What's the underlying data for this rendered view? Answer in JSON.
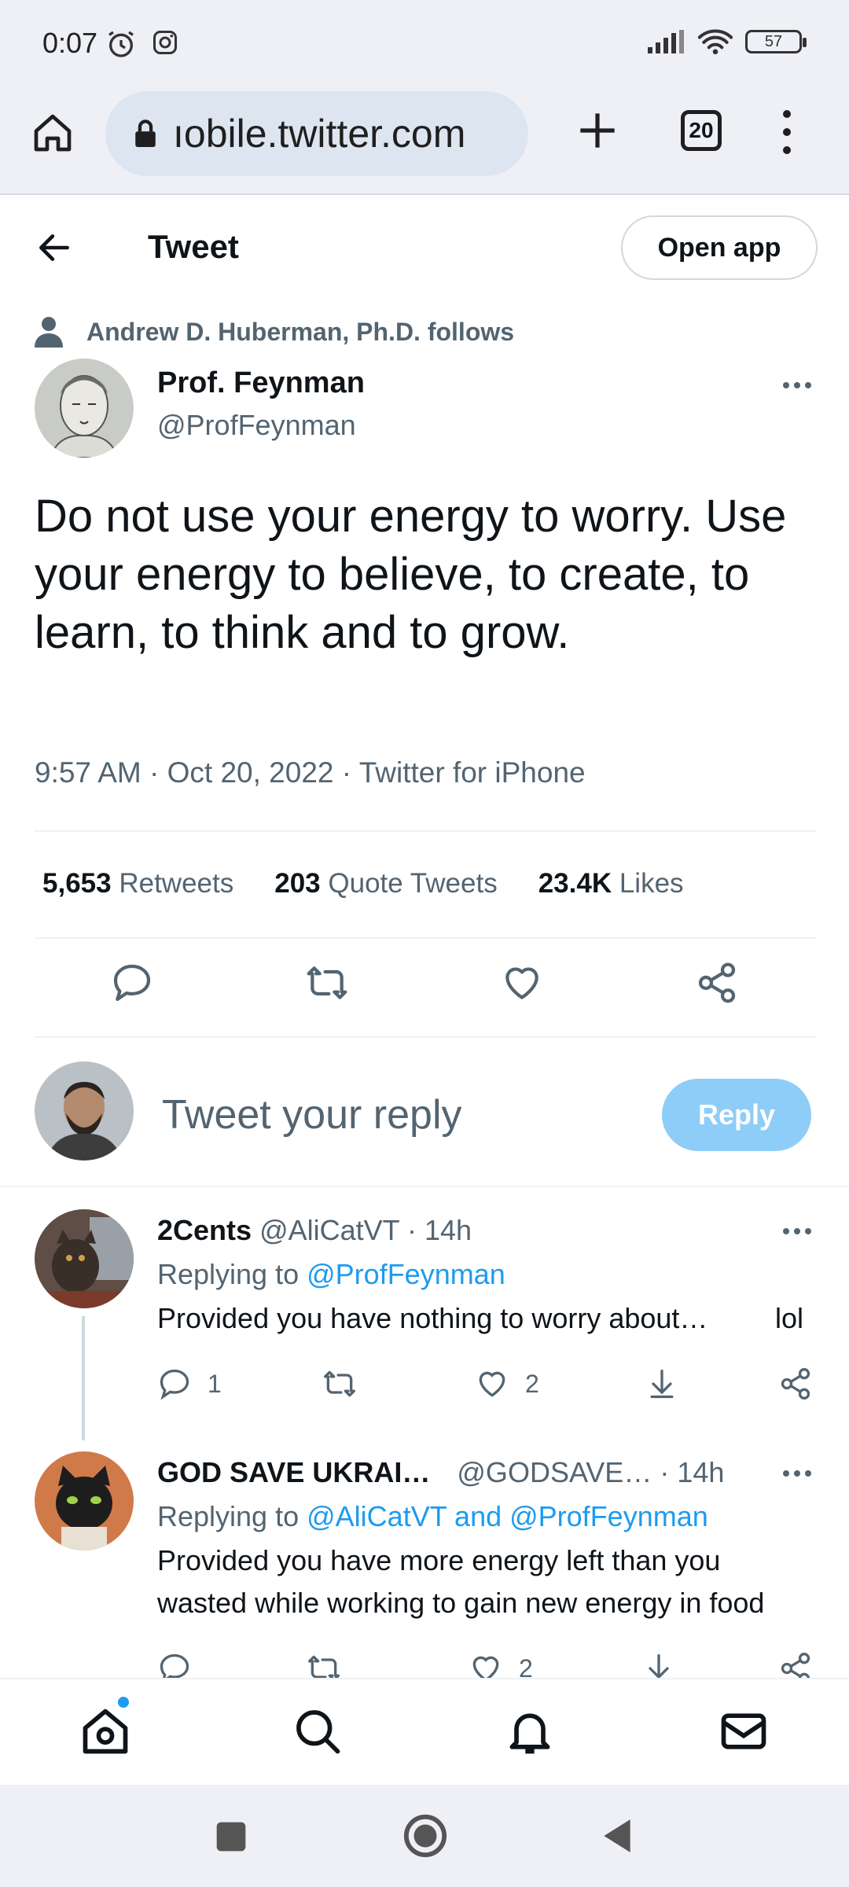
{
  "status": {
    "time": "0:07",
    "battery": "57"
  },
  "browser": {
    "url": "ıobile.twitter.com",
    "tab_count": "20"
  },
  "header": {
    "title": "Tweet",
    "open_app": "Open app"
  },
  "tweet": {
    "social_context": "Andrew D. Huberman, Ph.D. follows",
    "author_name": "Prof. Feynman",
    "author_handle": "@ProfFeynman",
    "text": "Do not use your energy to worry. Use your energy to believe, to create, to learn, to think and to grow.",
    "meta": "9:57 AM · Oct 20, 2022 · Twitter for iPhone",
    "stats": {
      "retweets_count": "5,653",
      "retweets_label": "Retweets",
      "quotes_count": "203",
      "quotes_label": "Quote Tweets",
      "likes_count": "23.4K",
      "likes_label": "Likes"
    }
  },
  "composer": {
    "placeholder": "Tweet your reply",
    "button": "Reply"
  },
  "replies": [
    {
      "name": "2Cents",
      "handle": "@AliCatVT",
      "time": "· 14h",
      "replying_prefix": "Replying to",
      "replying_to": "@ProfFeynman",
      "text": "Provided you have nothing to worry about…",
      "text_end": "lol",
      "reply_count": "1",
      "retweet_count": "",
      "like_count": "2"
    },
    {
      "name": "GOD SAVE UKRAI…",
      "handle": "@GODSAVE…",
      "time": "· 14h",
      "replying_prefix": "Replying to",
      "replying_to": "@AliCatVT and @ProfFeynman",
      "text_line1": "Provided you have more energy left than you",
      "text_line2": "wasted while working to gain new energy in food",
      "reply_count": "",
      "retweet_count": "",
      "like_count": "2"
    }
  ],
  "colors": {
    "accent": "#1d9bf0",
    "reply_button": "#8ecdf8",
    "secondary_text": "#536471"
  }
}
